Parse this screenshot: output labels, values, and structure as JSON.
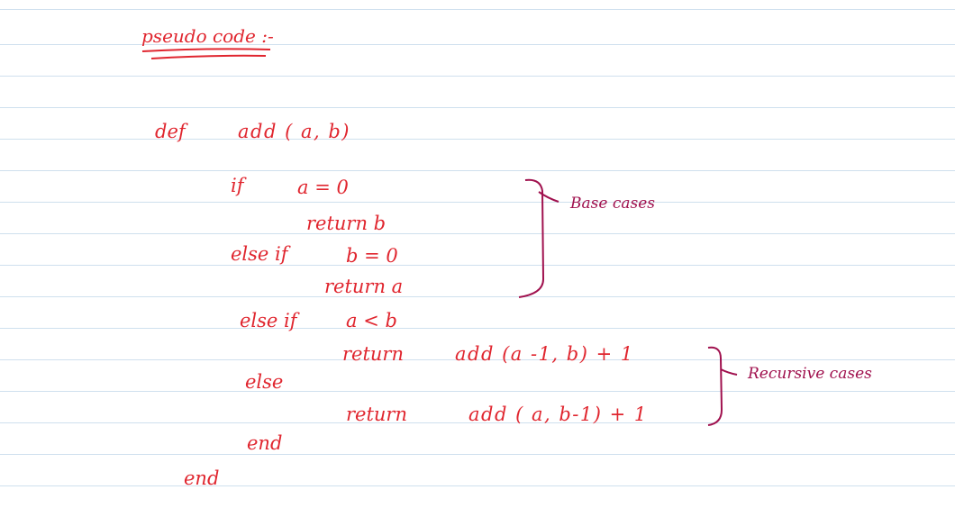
{
  "heading": "pseudo code :-",
  "code": {
    "def": "def",
    "signature": "add ( a, b)",
    "if_kw": "if",
    "if_cond": "a = 0",
    "ret_b": "return b",
    "elseif1_kw": "else if",
    "elseif1_cond": "b = 0",
    "ret_a": "return a",
    "elseif2_kw": "else if",
    "elseif2_cond": "a < b",
    "ret_kw_1": "return",
    "ret_expr_1": "add (a -1, b) + 1",
    "else_kw": "else",
    "ret_kw_2": "return",
    "ret_expr_2": "add ( a, b-1) + 1",
    "end_inner": "end",
    "end_outer": "end"
  },
  "annotations": {
    "base": "Base cases",
    "recursive": "Recursive cases"
  },
  "colors": {
    "ink_red": "#e0262f",
    "ink_maroon": "#a0114e",
    "rule_line": "#cfe0ee"
  }
}
